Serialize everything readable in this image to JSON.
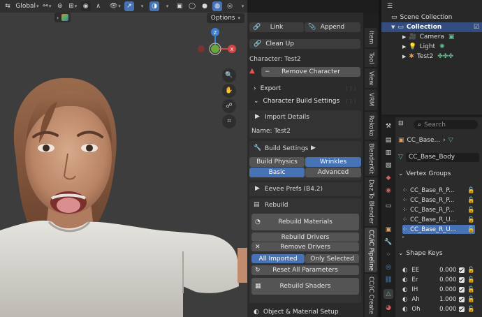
{
  "viewport": {
    "transform_orientation": "Global",
    "options_label": "Options",
    "gizmo": {
      "axis_z": "Z",
      "axis_x": "X"
    }
  },
  "npanel": {
    "link_label": "Link",
    "append_label": "Append",
    "cleanup_label": "Clean Up",
    "character_label": "Character: Test2",
    "remove_character_label": "Remove Character",
    "export_label": "Export",
    "build_settings_section": "Character Build Settings",
    "import_details_label": "Import Details",
    "name_label": "Name: Test2",
    "build_settings_label": "Build Settings",
    "build_physics_label": "Build Physics",
    "wrinkles_label": "Wrinkles",
    "basic_label": "Basic",
    "advanced_label": "Advanced",
    "eevee_prefs_label": "Eevee Prefs (B4.2)",
    "rebuild_label": "Rebuild",
    "rebuild_materials_label": "Rebuild Materials",
    "rebuild_drivers_label": "Rebuild Drivers",
    "remove_drivers_label": "Remove Drivers",
    "all_imported_label": "All Imported",
    "only_selected_label": "Only Selected",
    "reset_params_label": "Reset All Parameters",
    "rebuild_shaders_label": "Rebuild Shaders",
    "object_material_label": "Object & Material Setup"
  },
  "tabs": [
    "Item",
    "Tool",
    "View",
    "VRM",
    "Rokoko",
    "BlenderKit",
    "Daz To Blender",
    "CC/iC Pipeline",
    "CC/iC Create"
  ],
  "outliner": {
    "scene_collection": "Scene Collection",
    "collection": "Collection",
    "items": [
      "Camera",
      "Light",
      "Test2"
    ]
  },
  "properties": {
    "search_placeholder": "Search",
    "breadcrumb_object": "CC_Base...",
    "mesh_name": "CC_Base_Body",
    "vertex_groups_label": "Vertex Groups",
    "vertex_groups": [
      "CC_Base_R_P...",
      "CC_Base_R_P...",
      "CC_Base_R_P...",
      "CC_Base_R_U...",
      "CC_Base_R_U..."
    ],
    "shape_keys_label": "Shape Keys",
    "shape_keys": [
      {
        "name": "EE",
        "value": "0.000"
      },
      {
        "name": "Er",
        "value": "0.000"
      },
      {
        "name": "IH",
        "value": "0.000"
      },
      {
        "name": "Ah",
        "value": "1.000"
      },
      {
        "name": "Oh",
        "value": "0.000"
      }
    ]
  },
  "colors": {
    "accent": "#4772b3",
    "panel": "#2b2b2b",
    "viewport": "#3d3d3d",
    "button": "#545454"
  }
}
